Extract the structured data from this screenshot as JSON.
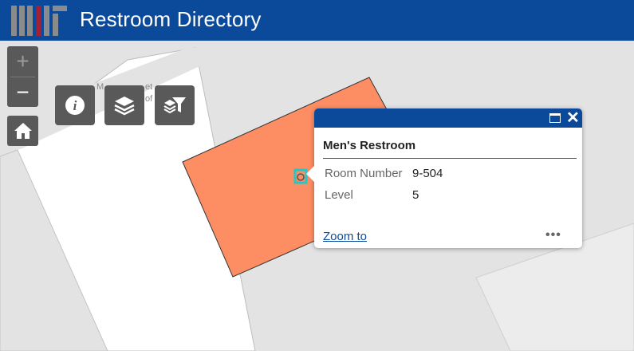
{
  "header": {
    "title": "Restroom Directory",
    "logo_name": "MIT logo",
    "background": "#0b4a9a"
  },
  "controls": {
    "zoom_in": "+",
    "zoom_out": "−",
    "home_icon": "home-icon",
    "tools": [
      "info-icon",
      "layers-icon",
      "layer-filter-icon"
    ]
  },
  "map": {
    "partial_labels": [
      "M",
      "et",
      "of"
    ],
    "feature_color": "#fd8d62",
    "selection_color": "#00ffff"
  },
  "popup": {
    "title": "Men's Restroom",
    "fields": [
      {
        "label": "Room Number",
        "value": "9-504"
      },
      {
        "label": "Level",
        "value": "5"
      }
    ],
    "zoom_to_label": "Zoom to",
    "more_label": "•••"
  }
}
